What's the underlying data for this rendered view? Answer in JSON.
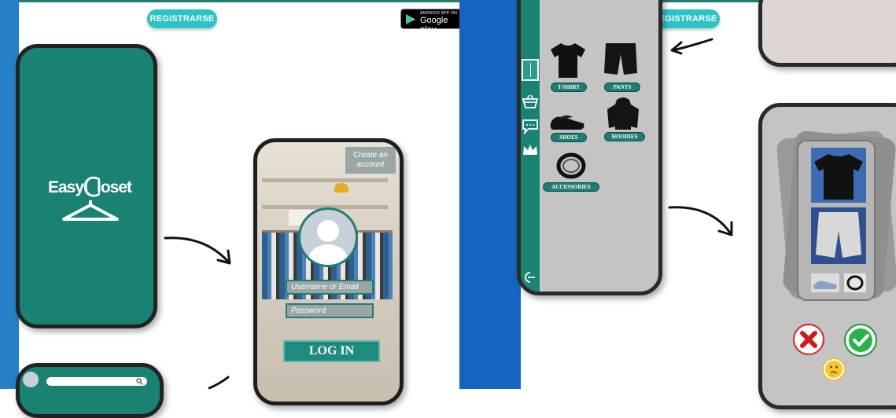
{
  "left_panel": {
    "register_label": "REGISTRARSE",
    "google_play": {
      "small_text": "ANDROID APP ON",
      "big_text": "Google play"
    },
    "splash": {
      "logo_text_1": "Easy",
      "logo_text_2": "loset"
    },
    "login": {
      "create_account": "Create an account",
      "username_placeholder": "Username or Email",
      "password_placeholder": "Password",
      "login_label": "LOG IN"
    }
  },
  "right_panel": {
    "register_label": "REGISTRARSE",
    "categories": [
      {
        "label": "T-SHIRT"
      },
      {
        "label": "PANTS"
      },
      {
        "label": "SHOES"
      },
      {
        "label": "HOODIES"
      },
      {
        "label": "ACCESSORIES"
      }
    ]
  },
  "colors": {
    "teal": "#1f7d73",
    "cyan": "#2bc4c6",
    "blue_strip": "#2580c5",
    "blue_strip_right": "#1565c0",
    "phone_gray": "#c4c4c4"
  }
}
